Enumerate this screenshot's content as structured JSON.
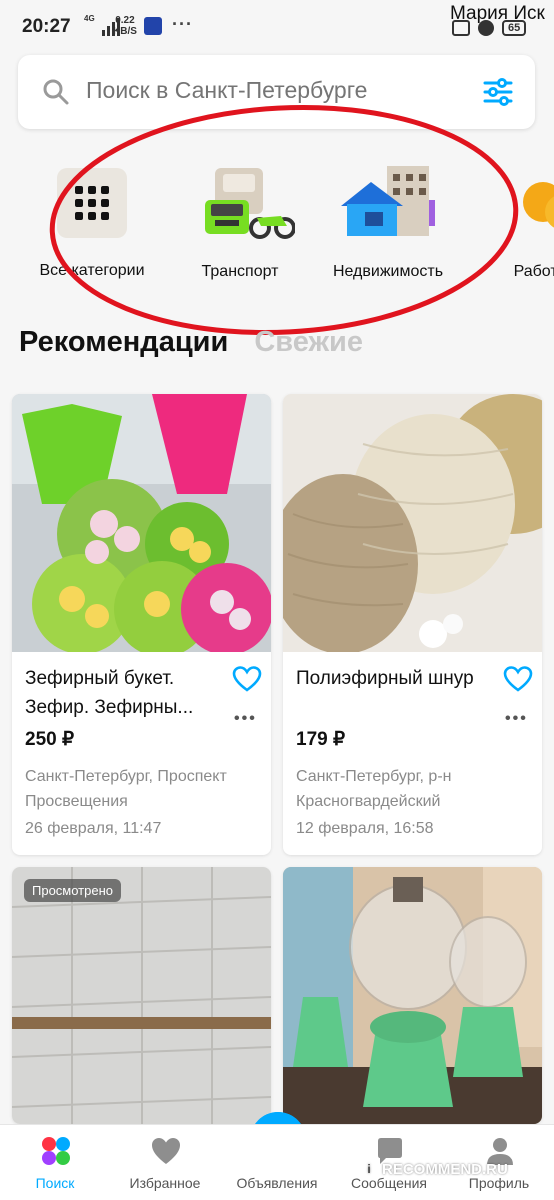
{
  "status_bar": {
    "time": "20:27",
    "network": "4G",
    "speed_value": "0.22",
    "speed_unit": "KB/S",
    "dots": "···",
    "user_name": "Мария Иск",
    "battery": "65"
  },
  "search": {
    "placeholder": "Поиск в Санкт-Петербурге",
    "value": ""
  },
  "categories": [
    {
      "label": "Все категории",
      "icon": "grid-icon"
    },
    {
      "label": "Транспорт",
      "icon": "transport-icon"
    },
    {
      "label": "Недвижимость",
      "icon": "realty-icon"
    },
    {
      "label": "Работа",
      "icon": "coins-icon"
    }
  ],
  "feed_tabs": {
    "recommended": "Рекомендации",
    "fresh": "Свежие"
  },
  "listings": [
    {
      "title": "Зефирный букет. Зефир. Зефирны...",
      "price": "250 ₽",
      "location": "Санкт-Петербург, Проспект Просвещения",
      "date": "26 февраля, 11:47",
      "more": "•••"
    },
    {
      "title": "Полиэфирный шнур",
      "price": "179 ₽",
      "location": "Санкт-Петербург, р-н Красногвардейский",
      "date": "12 февраля, 16:58",
      "more": "•••"
    },
    {
      "badge": "Просмотрено"
    },
    {}
  ],
  "bottom_nav": [
    {
      "label": "Поиск",
      "icon": "search-nav-icon"
    },
    {
      "label": "Избранное",
      "icon": "heart-nav-icon"
    },
    {
      "label": "Объявления",
      "icon": "add-listing-icon"
    },
    {
      "label": "Сообщения",
      "icon": "messages-nav-icon"
    },
    {
      "label": "Профиль",
      "icon": "profile-nav-icon"
    }
  ],
  "watermark": "RECOMMEND.RU",
  "watermark_mark": "i",
  "colors": {
    "accent": "#00aaff",
    "annotation": "#e0141e",
    "price": "#111111",
    "muted": "#8a8a8a"
  }
}
